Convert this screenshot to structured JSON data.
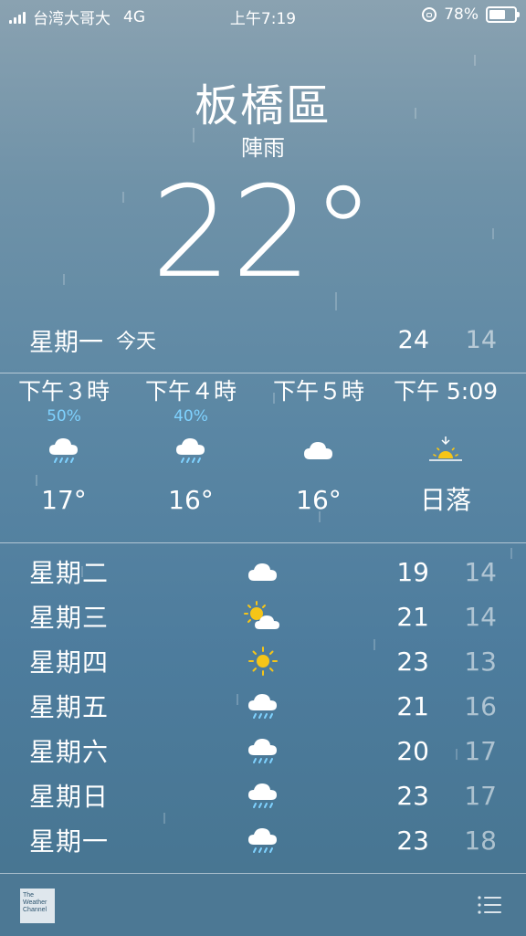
{
  "status_bar": {
    "carrier": "台湾大哥大",
    "network": "4G",
    "time": "上午7:19",
    "battery": "78%",
    "battery_level": 0.78
  },
  "location": {
    "city": "板橋區",
    "condition": "陣雨",
    "temperature": "22°"
  },
  "today": {
    "day": "星期一",
    "label": "今天",
    "high": "24",
    "low": "14"
  },
  "hourly": [
    {
      "time": "下午３時",
      "precip": "50%",
      "icon": "rain-cloud-icon",
      "value": "17°"
    },
    {
      "time": "下午４時",
      "precip": "40%",
      "icon": "rain-cloud-icon",
      "value": "16°"
    },
    {
      "time": "下午５時",
      "precip": "",
      "icon": "cloud-icon",
      "value": "16°"
    },
    {
      "time": "下午 5:09",
      "precip": "",
      "icon": "sunset-icon",
      "value": "日落"
    }
  ],
  "daily": [
    {
      "day": "星期二",
      "icon": "cloud-icon",
      "high": "19",
      "low": "14"
    },
    {
      "day": "星期三",
      "icon": "partly-sunny-icon",
      "high": "21",
      "low": "14"
    },
    {
      "day": "星期四",
      "icon": "sun-icon",
      "high": "23",
      "low": "13"
    },
    {
      "day": "星期五",
      "icon": "rain-cloud-icon",
      "high": "21",
      "low": "16"
    },
    {
      "day": "星期六",
      "icon": "rain-cloud-icon",
      "high": "20",
      "low": "17"
    },
    {
      "day": "星期日",
      "icon": "rain-cloud-icon",
      "high": "23",
      "low": "17"
    },
    {
      "day": "星期一",
      "icon": "rain-cloud-icon",
      "high": "23",
      "low": "18"
    }
  ],
  "footer": {
    "logo_text": "The Weather Channel",
    "list_icon": "list-icon"
  },
  "colors": {
    "precip_blue": "#7fd2ff",
    "sun_yellow": "#f5c518"
  }
}
